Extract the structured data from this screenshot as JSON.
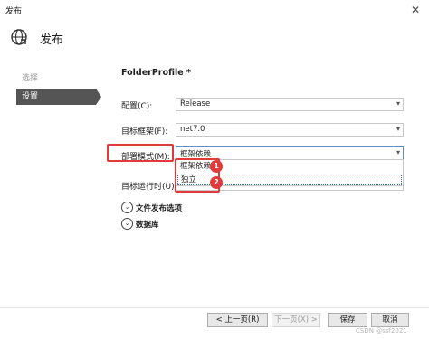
{
  "window": {
    "title": "发布",
    "close_glyph": "✕"
  },
  "header": {
    "title": "发布",
    "icon": "globe-publish-icon"
  },
  "steps": [
    {
      "label": "选择",
      "active": false
    },
    {
      "label": "设置",
      "active": true
    }
  ],
  "profile": {
    "name": "FolderProfile *"
  },
  "form": {
    "configuration": {
      "label": "配置(C):",
      "value": "Release"
    },
    "target_framework": {
      "label": "目标框架(F):",
      "value": "net7.0"
    },
    "deployment_mode": {
      "label": "部署模式(M):",
      "value": "框架依赖",
      "options": [
        "框架依赖",
        "独立"
      ]
    },
    "target_runtime": {
      "label": "目标运行时(U):",
      "value": ""
    }
  },
  "annotations": {
    "badge_1": "1",
    "badge_2": "2",
    "highlight_color": "#e03a3a"
  },
  "expanders": [
    {
      "label": "文件发布选项",
      "icon": "expand-chevron-icon"
    },
    {
      "label": "数据库",
      "icon": "expand-chevron-icon"
    }
  ],
  "buttons": {
    "prev": "< 上一页(R)",
    "next": "下一页(X) >",
    "save": "保存",
    "cancel": "取消"
  },
  "watermark": "CSDN @ssf2021",
  "colors": {
    "active_step": "#555555",
    "dropdown_focus": "#5a8fd6",
    "selection_outline": "#3a6ea5"
  }
}
